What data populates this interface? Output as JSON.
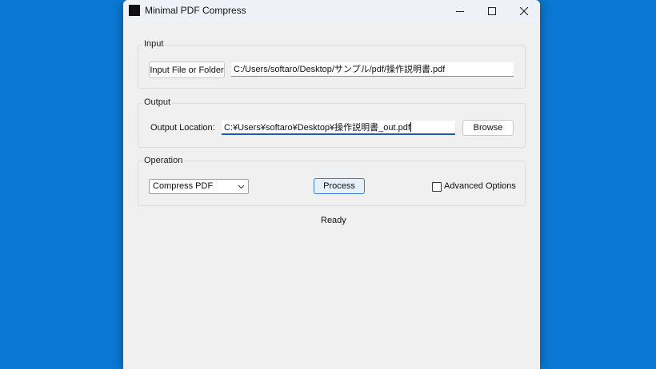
{
  "window": {
    "title": "Minimal PDF Compress",
    "controls": [
      "minimize-icon",
      "maximize-icon",
      "close-icon"
    ]
  },
  "input_group": {
    "title": "Input",
    "button_label": "Input File or Folder",
    "path_value": "C:/Users/softaro/Desktop/サンプル/pdf/操作説明書.pdf"
  },
  "output_group": {
    "title": "Output",
    "location_label": "Output Location:",
    "location_value": "C:¥Users¥softaro¥Desktop¥操作説明書_out.pdf",
    "browse_label": "Browse"
  },
  "operation_group": {
    "title": "Operation",
    "selected_operation": "Compress PDF",
    "process_label": "Process",
    "advanced_label": "Advanced Options",
    "advanced_checked": false
  },
  "status": "Ready",
  "colors": {
    "desktop": "#0a78d4",
    "window_bg": "#f0f0f0",
    "accent": "#1a5fb4"
  }
}
